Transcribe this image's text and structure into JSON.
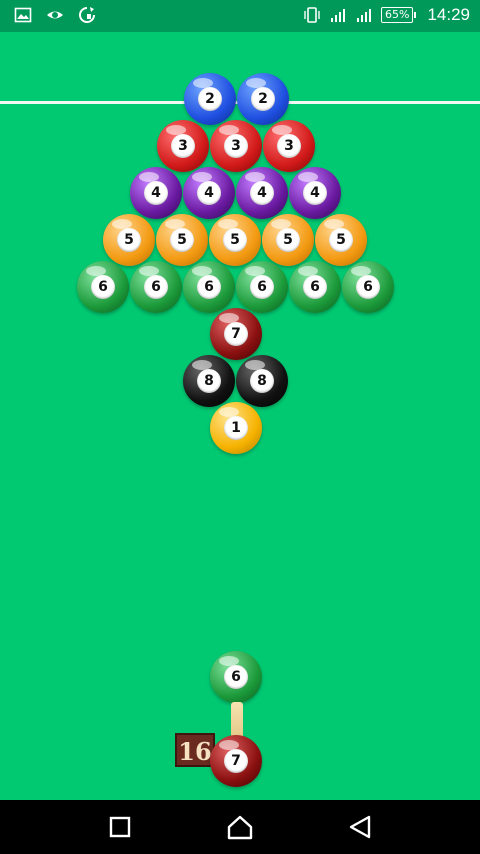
{
  "status_bar": {
    "battery_percent": "65%",
    "time": "14:29",
    "icons": [
      "image-icon",
      "eye-icon",
      "sync-icon",
      "vibrate-icon",
      "signal-icon",
      "signal-icon",
      "battery-icon"
    ]
  },
  "board": {
    "colors": {
      "background": "#00c972",
      "blue": "#1f4fe0",
      "red": "#d21a1a",
      "purple": "#6a1aa0",
      "orange": "#f39a12",
      "green": "#1c9a3a",
      "maroon": "#8a1010",
      "black": "#111111",
      "yellow": "#f6b200"
    },
    "rows": [
      [
        "2",
        "2"
      ],
      [
        "3",
        "3",
        "3"
      ],
      [
        "4",
        "4",
        "4",
        "4"
      ],
      [
        "5",
        "5",
        "5",
        "5",
        "5"
      ],
      [
        "6",
        "6",
        "6",
        "6",
        "6",
        "6"
      ],
      [
        "7"
      ],
      [
        "8",
        "8"
      ],
      [
        "1"
      ]
    ]
  },
  "shooter": {
    "next_ball": "6",
    "current_ball": "7",
    "counter": "16"
  },
  "nav": {
    "buttons": [
      "recent-apps-icon",
      "home-icon",
      "back-icon"
    ]
  }
}
